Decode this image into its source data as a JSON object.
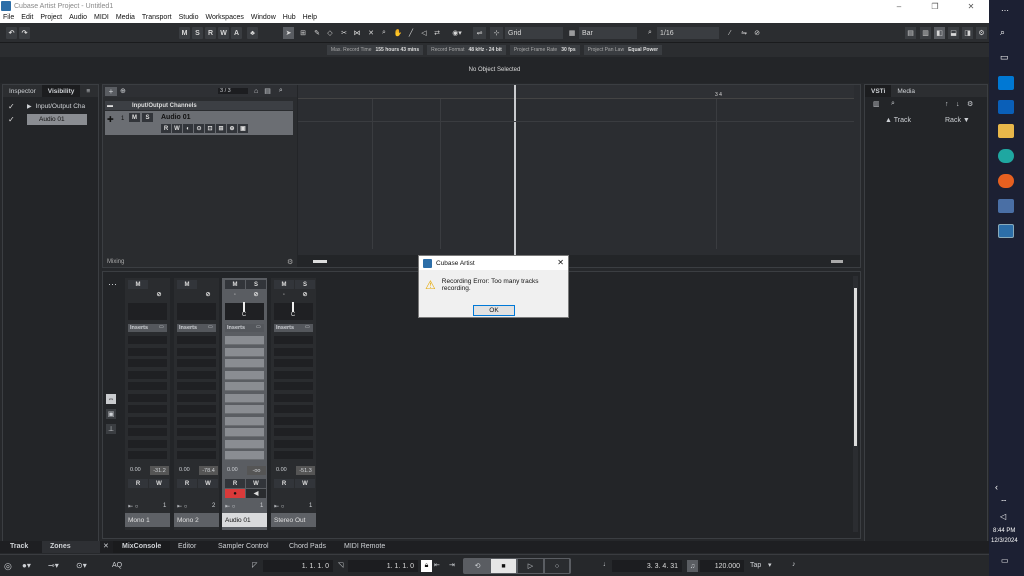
{
  "window": {
    "title": "Cubase Artist Project - Untitled1",
    "minimize": "–",
    "maximize": "❐",
    "close": "✕"
  },
  "menu": [
    "File",
    "Edit",
    "Project",
    "Audio",
    "MIDI",
    "Media",
    "Transport",
    "Studio",
    "Workspaces",
    "Window",
    "Hub",
    "Help"
  ],
  "toolbar": {
    "buttons_msrwa": [
      "M",
      "S",
      "R",
      "W",
      "A"
    ],
    "snap": "Grid",
    "grid_type": "Bar",
    "quantize": "1/16"
  },
  "info_line": [
    {
      "label": "Max. Record Time",
      "value": "155 hours 43 mins"
    },
    {
      "label": "Record Format",
      "value": "48 kHz - 24 bit"
    },
    {
      "label": "Project Frame Rate",
      "value": "30 fps"
    },
    {
      "label": "Project Pan Law",
      "value": "Equal Power"
    }
  ],
  "status": "No Object Selected",
  "left_zone": {
    "tabs": [
      "Inspector",
      "Visibility"
    ],
    "items": [
      "Input/Output Cha",
      "Audio 01"
    ]
  },
  "project": {
    "counter": "3 / 3",
    "folder": "Input/Output Channels",
    "track_number": "1",
    "track_name": "Audio 01",
    "track_buttons": [
      "M",
      "S"
    ],
    "track_buttons2": [
      "R",
      "W"
    ],
    "ruler_label": "3  4",
    "mixing_label": "Mixing"
  },
  "mixer": {
    "channels": [
      {
        "name": "Mono 1",
        "inserts": "Inserts",
        "vol": "0.00",
        "peak": "-31.2",
        "num": "1",
        "m": "M",
        "s": "",
        "r": "R",
        "w": "W"
      },
      {
        "name": "Mono 2",
        "inserts": "Inserts",
        "vol": "0.00",
        "peak": "-78.4",
        "num": "2",
        "m": "M",
        "s": "",
        "r": "R",
        "w": "W"
      },
      {
        "name": "Audio 01",
        "inserts": "Inserts",
        "vol": "0.00",
        "peak": "-oo",
        "num": "1",
        "m": "M",
        "s": "S",
        "r": "R",
        "w": "W",
        "pan": "C"
      },
      {
        "name": "Stereo Out",
        "inserts": "Inserts",
        "vol": "0.00",
        "peak": "-51.3",
        "num": "1",
        "m": "M",
        "s": "S",
        "r": "R",
        "w": "W",
        "pan": "C"
      }
    ]
  },
  "right_zone": {
    "tabs": [
      "VSTi",
      "Media"
    ],
    "track_label": "Track",
    "rack_label": "Rack"
  },
  "bottom_tabs": {
    "left": [
      "Track",
      "Zones"
    ],
    "lower": [
      "MixConsole",
      "Editor",
      "Sampler Control",
      "Chord Pads",
      "MIDI Remote"
    ]
  },
  "transport": {
    "left_locator": "1. 1. 1. 0",
    "right_locator": "1. 1. 1. 0",
    "position": "3. 3. 4. 31",
    "tempo": "120.000",
    "tap": "Tap",
    "aq": "AQ"
  },
  "dialog": {
    "title": "Cubase Artist",
    "message": "Recording Error: Too many tracks recording.",
    "ok": "OK"
  },
  "taskbar": {
    "time": "8:44 PM",
    "date": "12/3/2024"
  },
  "colors": {
    "accent": "#2c6ea8",
    "record": "#d93a3a",
    "background": "#26282b"
  }
}
